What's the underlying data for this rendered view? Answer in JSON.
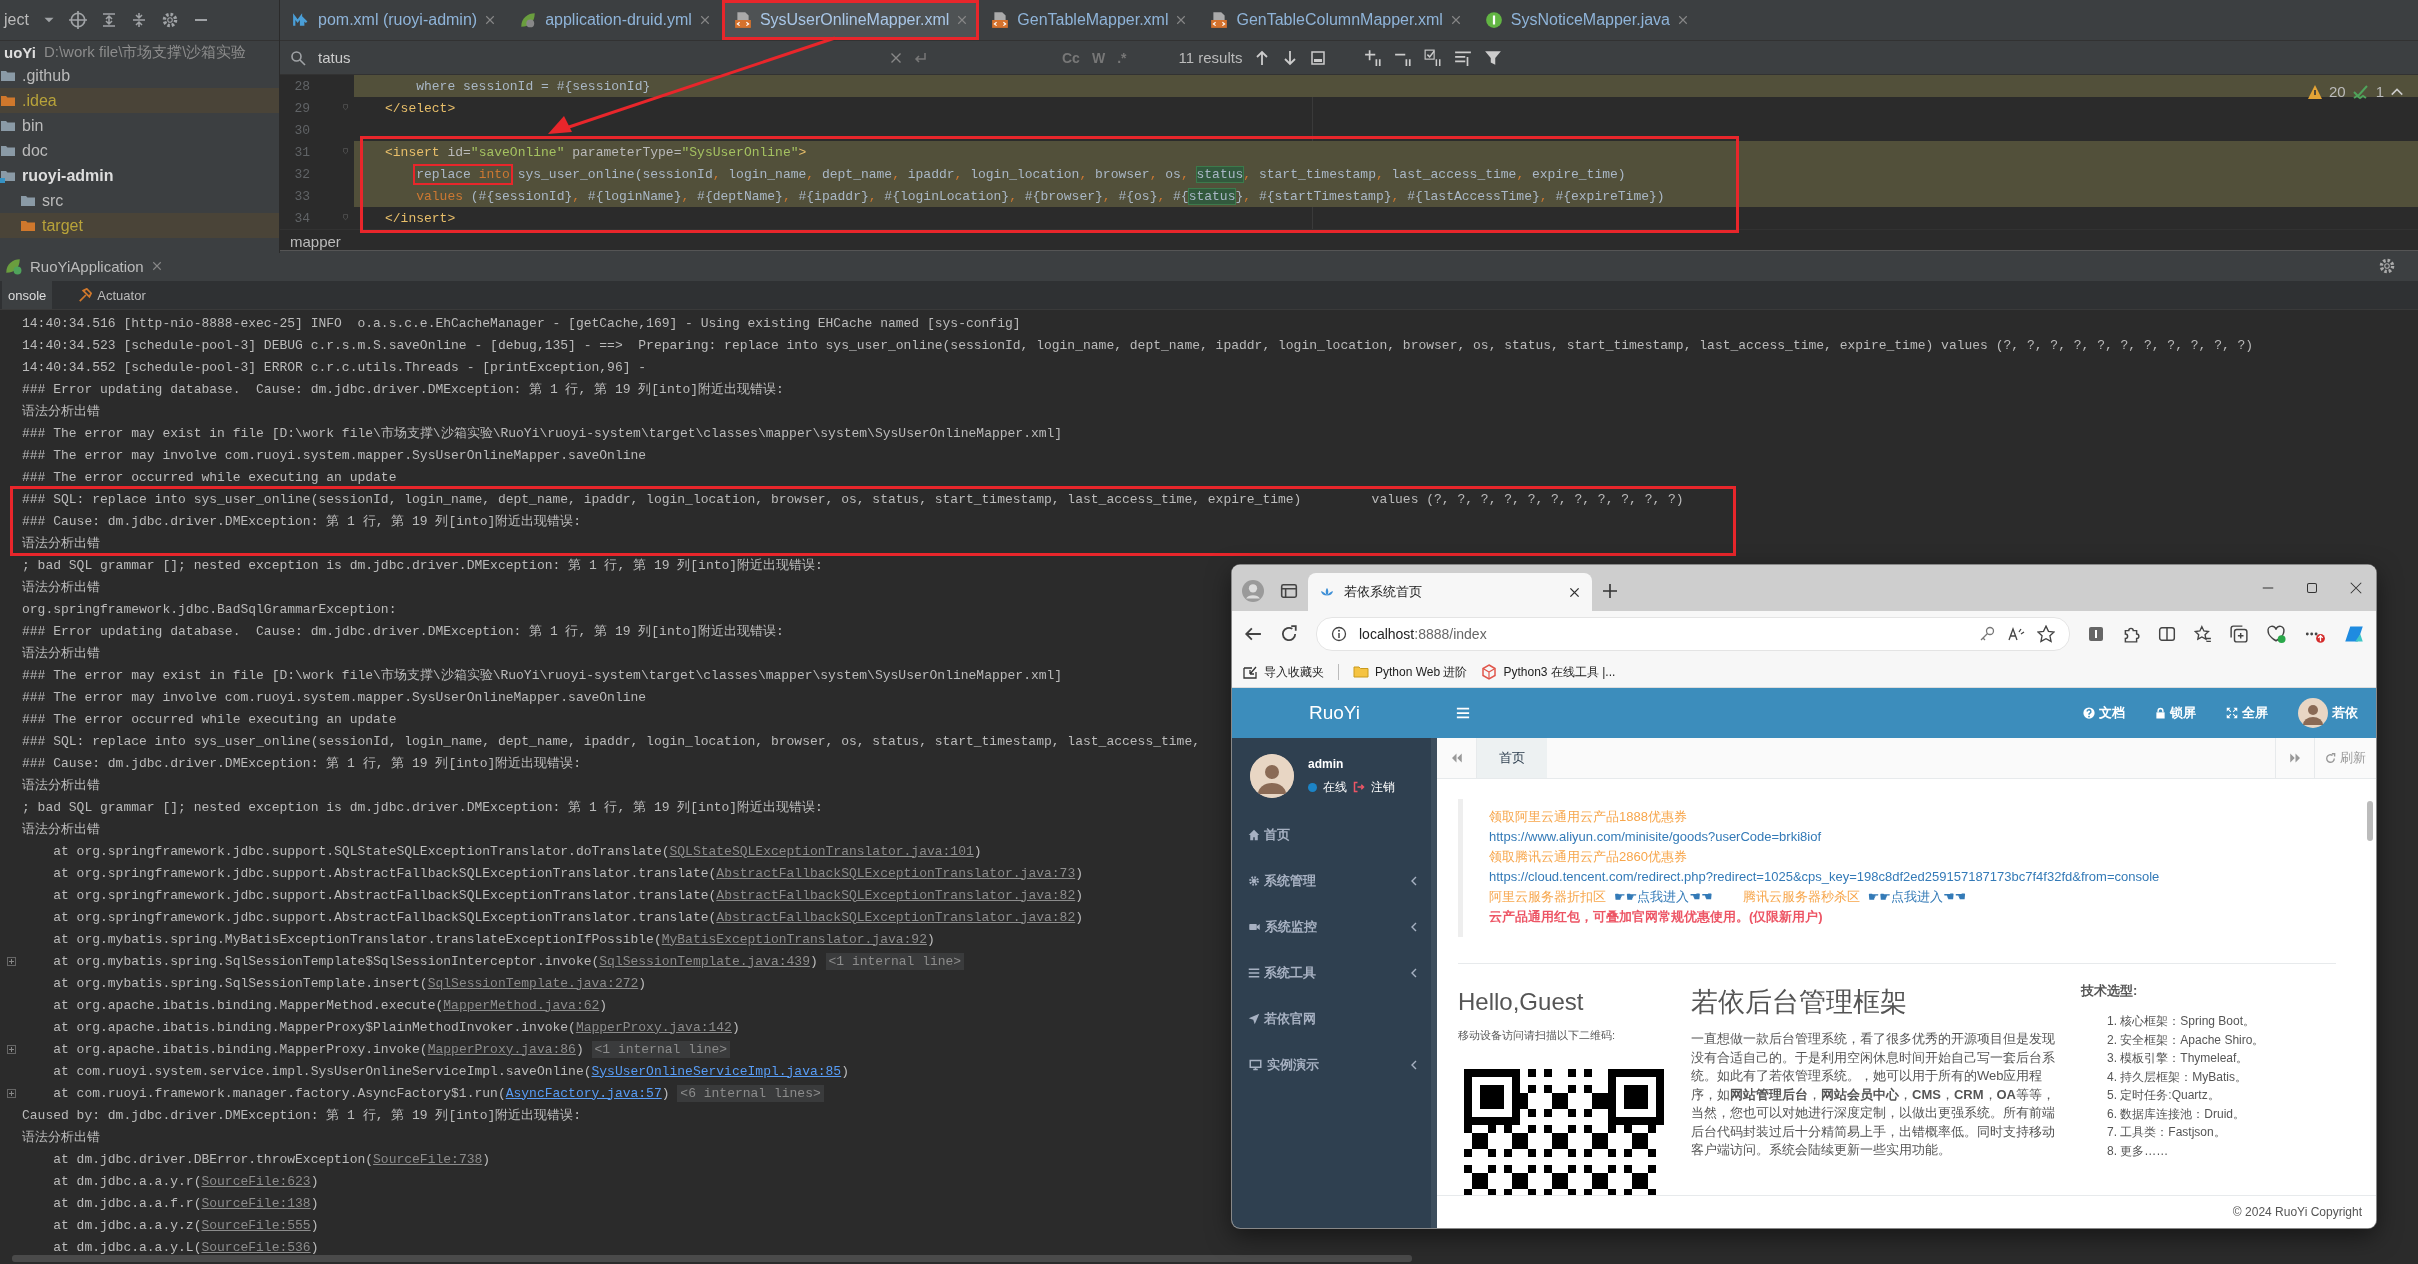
{
  "ide": {
    "project_panel": {
      "title": "ject",
      "root": {
        "name": "uoYi",
        "path": "D:\\work file\\市场支撑\\沙箱实验"
      },
      "tree": [
        {
          "label": ".github",
          "kind": "folder",
          "ignored": false
        },
        {
          "label": ".idea",
          "kind": "folder",
          "ignored": true
        },
        {
          "label": "bin",
          "kind": "folder",
          "ignored": false
        },
        {
          "label": "doc",
          "kind": "folder",
          "ignored": false
        },
        {
          "label": "ruoyi-admin",
          "kind": "module",
          "ignored": false,
          "children": [
            {
              "label": "src",
              "kind": "folder",
              "ignored": false
            },
            {
              "label": "target",
              "kind": "folder",
              "ignored": true
            }
          ]
        }
      ]
    },
    "editor_tabs": [
      {
        "label": "pom.xml (ruoyi-admin)",
        "kind": "maven",
        "selected": false,
        "boxed": false
      },
      {
        "label": "application-druid.yml",
        "kind": "yaml",
        "selected": false,
        "boxed": false
      },
      {
        "label": "SysUserOnlineMapper.xml",
        "kind": "xml",
        "selected": true,
        "boxed": true
      },
      {
        "label": "GenTableMapper.xml",
        "kind": "xml",
        "selected": false,
        "boxed": false
      },
      {
        "label": "GenTableColumnMapper.xml",
        "kind": "xml",
        "selected": false,
        "boxed": false
      },
      {
        "label": "SysNoticeMapper.java",
        "kind": "java",
        "selected": false,
        "boxed": false
      }
    ],
    "search": {
      "value": "tatus",
      "options": [
        "Cc",
        "W",
        ".*"
      ],
      "results": "11 results"
    },
    "inspections": {
      "warnings": "20",
      "passed": "1"
    },
    "code_lines": [
      {
        "number": "28",
        "highlighted": true,
        "boxed": false,
        "indented": true,
        "segments": [
          {
            "kind": "plain",
            "text": "where sessionId = #{sessionId}"
          }
        ]
      },
      {
        "number": "29",
        "highlighted": false,
        "boxed": false,
        "indented": false,
        "segments": [
          {
            "kind": "tag",
            "text": "</select>"
          }
        ]
      },
      {
        "number": "30",
        "highlighted": false,
        "boxed": false,
        "indented": false
      },
      {
        "number": "31",
        "highlighted": true,
        "boxed": true,
        "indented": false,
        "segments": [
          {
            "kind": "tag",
            "text": "<insert "
          },
          {
            "kind": "attr",
            "text": "id="
          },
          {
            "kind": "string",
            "text": "\"saveOnline\""
          },
          {
            "kind": "attr",
            "text": " parameterType="
          },
          {
            "kind": "string",
            "text": "\"SysUserOnline\""
          },
          {
            "kind": "tag",
            "text": ">"
          }
        ]
      },
      {
        "number": "32",
        "highlighted": true,
        "boxed": true,
        "indented": true,
        "segments": [
          {
            "kind": "framed",
            "parts": [
              {
                "kind": "plain",
                "text": "replace "
              },
              {
                "kind": "keyword",
                "text": "into"
              }
            ]
          },
          {
            "kind": "sql",
            "text": " sys_user_online(sessionId, login_name, dept_name, ipaddr, login_location, browser, os, "
          },
          {
            "kind": "match",
            "text": "status"
          },
          {
            "kind": "sql",
            "text": ", start_timestamp, last_access_time, expire_time)"
          }
        ]
      },
      {
        "number": "33",
        "highlighted": true,
        "boxed": true,
        "indented": true,
        "segments": [
          {
            "kind": "keyword",
            "text": "values "
          },
          {
            "kind": "sql",
            "text": "(#{sessionId}, #{loginName}, #{deptName}, #{ipaddr}, #{loginLocation}, #{browser}, #{os}, #{"
          },
          {
            "kind": "match",
            "text": "status"
          },
          {
            "kind": "sql",
            "text": "}, #{startTimestamp}, #{lastAccessTime}, #{expireTime})"
          }
        ]
      },
      {
        "number": "34",
        "highlighted": false,
        "boxed": true,
        "indented": false,
        "segments": [
          {
            "kind": "tag",
            "text": "</insert>"
          }
        ]
      }
    ],
    "breadcrumb": "mapper"
  },
  "run_panel": {
    "title": "RuoYiApplication",
    "tabs": [
      {
        "label": "onsole",
        "kind": "console",
        "selected": true
      },
      {
        "label": "Actuator",
        "kind": "actuator",
        "selected": false
      }
    ],
    "console": [
      {
        "foldable": false,
        "boxed": false,
        "segments": [
          {
            "kind": "plain",
            "text": "14:40:34.516 [http-nio-8888-exec-25] INFO  o.a.s.c.e.EhCacheManager - [getCache,169] - Using existing EHCache named [sys-config]"
          }
        ]
      },
      {
        "foldable": false,
        "boxed": false,
        "segments": [
          {
            "kind": "plain",
            "text": "14:40:34.523 [schedule-pool-3] DEBUG c.r.s.m.S.saveOnline - [debug,135] - ==>  Preparing: replace into sys_user_online(sessionId, login_name, dept_name, ipaddr, login_location, browser, os, status, start_timestamp, last_access_time, expire_time) values (?, ?, ?, ?, ?, ?, ?, ?, ?, ?, ?)"
          }
        ]
      },
      {
        "foldable": false,
        "boxed": false,
        "segments": [
          {
            "kind": "plain",
            "text": "14:40:34.552 [schedule-pool-3] ERROR c.r.c.utils.Threads - [printException,96] -"
          }
        ]
      },
      {
        "foldable": false,
        "boxed": false,
        "segments": [
          {
            "kind": "plain",
            "text": "### Error updating database.  Cause: dm.jdbc.driver.DMException: 第 1 行, 第 19 列[into]附近出现错误:"
          }
        ]
      },
      {
        "foldable": false,
        "boxed": false,
        "segments": [
          {
            "kind": "plain",
            "text": "语法分析出错"
          }
        ]
      },
      {
        "foldable": false,
        "boxed": false,
        "segments": [
          {
            "kind": "plain",
            "text": "### The error may exist in file [D:\\work file\\市场支撑\\沙箱实验\\RuoYi\\ruoyi-system\\target\\classes\\mapper\\system\\SysUserOnlineMapper.xml]"
          }
        ]
      },
      {
        "foldable": false,
        "boxed": false,
        "segments": [
          {
            "kind": "plain",
            "text": "### The error may involve com.ruoyi.system.mapper.SysUserOnlineMapper.saveOnline"
          }
        ]
      },
      {
        "foldable": false,
        "boxed": false,
        "segments": [
          {
            "kind": "plain",
            "text": "### The error occurred while executing an update"
          }
        ]
      },
      {
        "foldable": false,
        "boxed": true,
        "segments": [
          {
            "kind": "plain",
            "text": "### SQL: replace into sys_user_online(sessionId, login_name, dept_name, ipaddr, login_location, browser, os, status, start_timestamp, last_access_time, expire_time)         values (?, ?, ?, ?, ?, ?, ?, ?, ?, ?, ?)"
          }
        ]
      },
      {
        "foldable": false,
        "boxed": true,
        "segments": [
          {
            "kind": "plain",
            "text": "### Cause: dm.jdbc.driver.DMException: 第 1 行, 第 19 列[into]附近出现错误:"
          }
        ]
      },
      {
        "foldable": false,
        "boxed": true,
        "segments": [
          {
            "kind": "plain",
            "text": "语法分析出错"
          }
        ]
      },
      {
        "foldable": false,
        "boxed": false,
        "segments": [
          {
            "kind": "plain",
            "text": "; bad SQL grammar []; nested exception is dm.jdbc.driver.DMException: 第 1 行, 第 19 列[into]附近出现错误:"
          }
        ]
      },
      {
        "foldable": false,
        "boxed": false,
        "segments": [
          {
            "kind": "plain",
            "text": "语法分析出错"
          }
        ]
      },
      {
        "foldable": false,
        "boxed": false,
        "segments": [
          {
            "kind": "plain",
            "text": "org.springframework.jdbc.BadSqlGrammarException:"
          }
        ]
      },
      {
        "foldable": false,
        "boxed": false,
        "segments": [
          {
            "kind": "plain",
            "text": "### Error updating database.  Cause: dm.jdbc.driver.DMException: 第 1 行, 第 19 列[into]附近出现错误:"
          }
        ]
      },
      {
        "foldable": false,
        "boxed": false,
        "segments": [
          {
            "kind": "plain",
            "text": "语法分析出错"
          }
        ]
      },
      {
        "foldable": false,
        "boxed": false,
        "segments": [
          {
            "kind": "plain",
            "text": "### The error may exist in file [D:\\work file\\市场支撑\\沙箱实验\\RuoYi\\ruoyi-system\\target\\classes\\mapper\\system\\SysUserOnlineMapper.xml]"
          }
        ]
      },
      {
        "foldable": false,
        "boxed": false,
        "segments": [
          {
            "kind": "plain",
            "text": "### The error may involve com.ruoyi.system.mapper.SysUserOnlineMapper.saveOnline"
          }
        ]
      },
      {
        "foldable": false,
        "boxed": false,
        "segments": [
          {
            "kind": "plain",
            "text": "### The error occurred while executing an update"
          }
        ]
      },
      {
        "foldable": false,
        "boxed": false,
        "segments": [
          {
            "kind": "plain",
            "text": "### SQL: replace into sys_user_online(sessionId, login_name, dept_name, ipaddr, login_location, browser, os, status, start_timestamp, last_access_time,"
          }
        ]
      },
      {
        "foldable": false,
        "boxed": false,
        "segments": [
          {
            "kind": "plain",
            "text": "### Cause: dm.jdbc.driver.DMException: 第 1 行, 第 19 列[into]附近出现错误:"
          }
        ]
      },
      {
        "foldable": false,
        "boxed": false,
        "segments": [
          {
            "kind": "plain",
            "text": "语法分析出错"
          }
        ]
      },
      {
        "foldable": false,
        "boxed": false,
        "segments": [
          {
            "kind": "plain",
            "text": "; bad SQL grammar []; nested exception is dm.jdbc.driver.DMException: 第 1 行, 第 19 列[into]附近出现错误:"
          }
        ]
      },
      {
        "foldable": false,
        "boxed": false,
        "segments": [
          {
            "kind": "plain",
            "text": "语法分析出错"
          }
        ]
      },
      {
        "foldable": false,
        "boxed": false,
        "segments": [
          {
            "kind": "plain",
            "text": "    at org.springframework.jdbc.support.SQLStateSQLExceptionTranslator.doTranslate("
          },
          {
            "kind": "link",
            "text": "SQLStateSQLExceptionTranslator.java:101"
          },
          {
            "kind": "plain",
            "text": ")"
          }
        ]
      },
      {
        "foldable": false,
        "boxed": false,
        "segments": [
          {
            "kind": "plain",
            "text": "    at org.springframework.jdbc.support.AbstractFallbackSQLExceptionTranslator.translate("
          },
          {
            "kind": "link",
            "text": "AbstractFallbackSQLExceptionTranslator.java:73"
          },
          {
            "kind": "plain",
            "text": ")"
          }
        ]
      },
      {
        "foldable": false,
        "boxed": false,
        "segments": [
          {
            "kind": "plain",
            "text": "    at org.springframework.jdbc.support.AbstractFallbackSQLExceptionTranslator.translate("
          },
          {
            "kind": "link",
            "text": "AbstractFallbackSQLExceptionTranslator.java:82"
          },
          {
            "kind": "plain",
            "text": ")"
          }
        ]
      },
      {
        "foldable": false,
        "boxed": false,
        "segments": [
          {
            "kind": "plain",
            "text": "    at org.springframework.jdbc.support.AbstractFallbackSQLExceptionTranslator.translate("
          },
          {
            "kind": "link",
            "text": "AbstractFallbackSQLExceptionTranslator.java:82"
          },
          {
            "kind": "plain",
            "text": ")"
          }
        ]
      },
      {
        "foldable": false,
        "boxed": false,
        "segments": [
          {
            "kind": "plain",
            "text": "    at org.mybatis.spring.MyBatisExceptionTranslator.translateExceptionIfPossible("
          },
          {
            "kind": "link",
            "text": "MyBatisExceptionTranslator.java:92"
          },
          {
            "kind": "plain",
            "text": ")"
          }
        ]
      },
      {
        "foldable": true,
        "boxed": false,
        "segments": [
          {
            "kind": "plain",
            "text": "    at org.mybatis.spring.SqlSessionTemplate$SqlSessionInterceptor.invoke("
          },
          {
            "kind": "link",
            "text": "SqlSessionTemplate.java:439"
          },
          {
            "kind": "plain",
            "text": ") "
          },
          {
            "kind": "folded",
            "text": "<1 internal line>"
          }
        ]
      },
      {
        "foldable": false,
        "boxed": false,
        "segments": [
          {
            "kind": "plain",
            "text": "    at org.mybatis.spring.SqlSessionTemplate.insert("
          },
          {
            "kind": "link",
            "text": "SqlSessionTemplate.java:272"
          },
          {
            "kind": "plain",
            "text": ")"
          }
        ]
      },
      {
        "foldable": false,
        "boxed": false,
        "segments": [
          {
            "kind": "plain",
            "text": "    at org.apache.ibatis.binding.MapperMethod.execute("
          },
          {
            "kind": "link",
            "text": "MapperMethod.java:62"
          },
          {
            "kind": "plain",
            "text": ")"
          }
        ]
      },
      {
        "foldable": false,
        "boxed": false,
        "segments": [
          {
            "kind": "plain",
            "text": "    at org.apache.ibatis.binding.MapperProxy$PlainMethodInvoker.invoke("
          },
          {
            "kind": "link",
            "text": "MapperProxy.java:142"
          },
          {
            "kind": "plain",
            "text": ")"
          }
        ]
      },
      {
        "foldable": true,
        "boxed": false,
        "segments": [
          {
            "kind": "plain",
            "text": "    at org.apache.ibatis.binding.MapperProxy.invoke("
          },
          {
            "kind": "link",
            "text": "MapperProxy.java:86"
          },
          {
            "kind": "plain",
            "text": ") "
          },
          {
            "kind": "folded",
            "text": "<1 internal line>"
          }
        ]
      },
      {
        "foldable": false,
        "boxed": false,
        "segments": [
          {
            "kind": "plain",
            "text": "    at com.ruoyi.system.service.impl.SysUserOnlineServiceImpl.saveOnline("
          },
          {
            "kind": "source-link",
            "text": "SysUserOnlineServiceImpl.java:85"
          },
          {
            "kind": "plain",
            "text": ")"
          }
        ]
      },
      {
        "foldable": true,
        "boxed": false,
        "segments": [
          {
            "kind": "plain",
            "text": "    at com.ruoyi.framework.manager.factory.AsyncFactory$1.run("
          },
          {
            "kind": "source-link",
            "text": "AsyncFactory.java:57"
          },
          {
            "kind": "plain",
            "text": ") "
          },
          {
            "kind": "folded",
            "text": "<6 internal lines>"
          }
        ]
      },
      {
        "foldable": false,
        "boxed": false,
        "segments": [
          {
            "kind": "plain",
            "text": "Caused by: dm.jdbc.driver.DMException: 第 1 行, 第 19 列[into]附近出现错误:"
          }
        ]
      },
      {
        "foldable": false,
        "boxed": false,
        "segments": [
          {
            "kind": "plain",
            "text": "语法分析出错"
          }
        ]
      },
      {
        "foldable": false,
        "boxed": false,
        "segments": [
          {
            "kind": "plain",
            "text": "    at dm.jdbc.driver.DBError.throwException("
          },
          {
            "kind": "link",
            "text": "SourceFile:738"
          },
          {
            "kind": "plain",
            "text": ")"
          }
        ]
      },
      {
        "foldable": false,
        "boxed": false,
        "segments": [
          {
            "kind": "plain",
            "text": "    at dm.jdbc.a.a.y.r("
          },
          {
            "kind": "link",
            "text": "SourceFile:623"
          },
          {
            "kind": "plain",
            "text": ")"
          }
        ]
      },
      {
        "foldable": false,
        "boxed": false,
        "segments": [
          {
            "kind": "plain",
            "text": "    at dm.jdbc.a.a.f.r("
          },
          {
            "kind": "link",
            "text": "SourceFile:138"
          },
          {
            "kind": "plain",
            "text": ")"
          }
        ]
      },
      {
        "foldable": false,
        "boxed": false,
        "segments": [
          {
            "kind": "plain",
            "text": "    at dm.jdbc.a.a.y.z("
          },
          {
            "kind": "link",
            "text": "SourceFile:555"
          },
          {
            "kind": "plain",
            "text": ")"
          }
        ]
      },
      {
        "foldable": false,
        "boxed": false,
        "segments": [
          {
            "kind": "plain",
            "text": "    at dm.jdbc.a.a.y.L("
          },
          {
            "kind": "link",
            "text": "SourceFile:536"
          },
          {
            "kind": "plain",
            "text": ")"
          }
        ]
      }
    ]
  },
  "browser": {
    "tab_title": "若依系统首页",
    "address": {
      "host": "localhost",
      "path": ":8888/index"
    },
    "bookmarks": [
      {
        "label": "导入收藏夹",
        "kind": "import"
      },
      {
        "label": "Python Web 进阶",
        "kind": "folder"
      },
      {
        "label": "Python3 在线工具 |...",
        "kind": "site"
      }
    ],
    "app": {
      "logo": "RuoYi",
      "header_links": [
        {
          "label": "文档",
          "kind": "help"
        },
        {
          "label": "锁屏",
          "kind": "lock"
        },
        {
          "label": "全屏",
          "kind": "fullscreen"
        }
      ],
      "user_name": "若依",
      "sidebar": {
        "user": "admin",
        "status": "在线",
        "logout": "注销",
        "menu": [
          {
            "label": "首页",
            "kind": "home",
            "expandable": false
          },
          {
            "label": "系统管理",
            "kind": "gear",
            "expandable": true
          },
          {
            "label": "系统监控",
            "kind": "camera",
            "expandable": true
          },
          {
            "label": "系统工具",
            "kind": "bars",
            "expandable": true
          },
          {
            "label": "若依官网",
            "kind": "send",
            "expandable": false
          },
          {
            "label": "实例演示",
            "kind": "monitor",
            "expandable": true
          }
        ]
      },
      "page_tabs": [
        {
          "label": "首页",
          "selected": true
        }
      ],
      "refresh": "刷新",
      "notice": [
        [
          {
            "kind": "promo",
            "text": "领取阿里云通用云产品1888优惠券"
          }
        ],
        [
          {
            "kind": "link",
            "text": "https://www.aliyun.com/minisite/goods?userCode=brki8iof"
          }
        ],
        [
          {
            "kind": "promo",
            "text": "领取腾讯云通用云产品2860优惠券"
          }
        ],
        [
          {
            "kind": "link",
            "text": "https://cloud.tencent.com/redirect.php?redirect=1025&cps_key=198c8df2ed259157187173bc7f4f32fd&from=console"
          }
        ],
        [
          {
            "kind": "promo",
            "text": "阿里云服务器折扣区"
          },
          {
            "kind": "link",
            "text": "☛☛点我进入☚☚"
          },
          {
            "kind": "promo",
            "text": "腾讯云服务器秒杀区"
          },
          {
            "kind": "link",
            "text": "☛☛点我进入☚☚"
          }
        ],
        [
          {
            "kind": "alert",
            "text": "云产品通用红包，可叠加官网常规优惠使用。(仅限新用户)"
          }
        ]
      ],
      "welcome": {
        "title": "Hello,Guest",
        "qr_hint": "移动设备访问请扫描以下二维码:"
      },
      "intro": {
        "title": "若依后台管理框架",
        "text": "一直想做一款后台管理系统，看了很多优秀的开源项目但是发现没有合适自己的。于是利用空闲休息时间开始自己写一套后台系统。如此有了若依管理系统。，她可以用于所有的Web应用程序，如**网站管理后台**，**网站会员中心**，**CMS**，**CRM**，**OA**等等，当然，您也可以对她进行深度定制，以做出更强系统。所有前端后台代码封装过后十分精简易上手，出错概率低。同时支持移动客户端访问。系统会陆续更新一些实用功能。"
      },
      "tech": {
        "title": "技术选型:",
        "items": [
          "1. 核心框架：Spring Boot。",
          "2. 安全框架：Apache Shiro。",
          "3. 模板引擎：Thymeleaf。",
          "4. 持久层框架：MyBatis。",
          "5. 定时任务:Quartz。",
          "6. 数据库连接池：Druid。",
          "7. 工具类：Fastjson。",
          "8. 更多……"
        ]
      },
      "footer": "© 2024 RuoYi Copyright"
    }
  }
}
